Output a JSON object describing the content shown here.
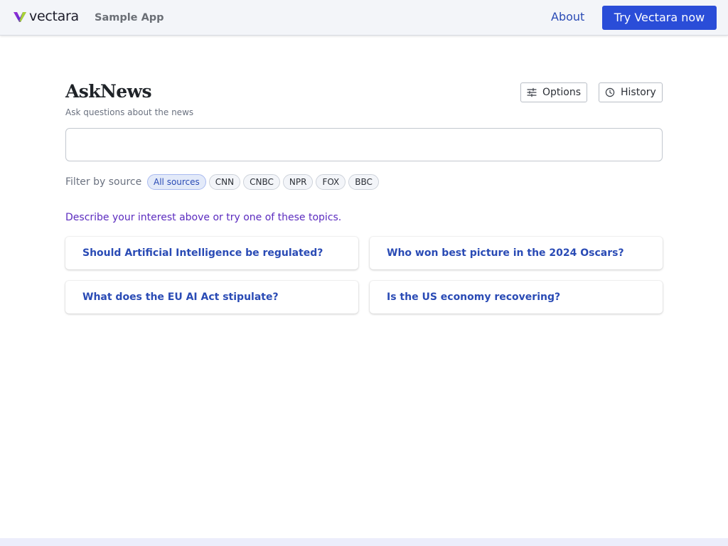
{
  "header": {
    "brand_name": "vectara",
    "app_label": "Sample App",
    "about_label": "About",
    "try_label": "Try Vectara now",
    "brand_icon": "vectara-logo-icon"
  },
  "main": {
    "title": "AskNews",
    "subtitle": "Ask questions about the news",
    "options_label": "Options",
    "options_icon": "sliders-icon",
    "history_label": "History",
    "history_icon": "clock-icon",
    "search": {
      "value": "",
      "placeholder": ""
    },
    "filter": {
      "label": "Filter by source",
      "chips": [
        {
          "label": "All sources",
          "selected": true
        },
        {
          "label": "CNN",
          "selected": false
        },
        {
          "label": "CNBC",
          "selected": false
        },
        {
          "label": "NPR",
          "selected": false
        },
        {
          "label": "FOX",
          "selected": false
        },
        {
          "label": "BBC",
          "selected": false
        }
      ]
    },
    "prompt_text": "Describe your interest above or try one of these topics.",
    "topics": [
      "Should Artificial Intelligence be regulated?",
      "Who won best picture in the 2024 Oscars?",
      "What does the EU AI Act stipulate?",
      "Is the US economy recovering?"
    ]
  },
  "colors": {
    "accent": "#2a4dd8",
    "link": "#2a4bb5",
    "prompt": "#5b2bbf",
    "header_bg": "#f3f5f9"
  }
}
